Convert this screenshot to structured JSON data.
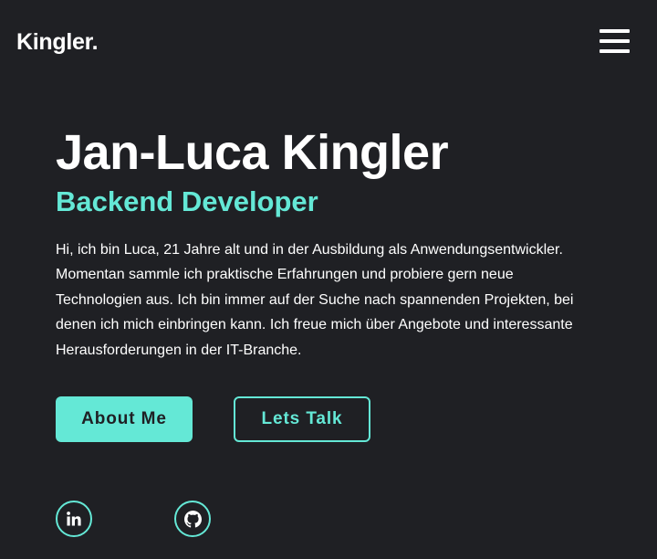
{
  "header": {
    "logo": "Kingler.",
    "menu_icon": "hamburger-menu-icon"
  },
  "hero": {
    "name": "Jan-Luca Kingler",
    "role": "Backend Developer",
    "intro": "Hi, ich bin Luca, 21 Jahre alt und in der Ausbildung als Anwendungsentwickler. Momentan sammle ich praktische Erfahrungen und probiere gern neue Technologien aus. Ich bin immer auf der Suche nach spannenden Projekten, bei denen ich mich einbringen kann. Ich freue mich über Angebote und interessante Herausforderungen in der IT-Branche."
  },
  "buttons": {
    "about": "About Me",
    "talk": "Lets Talk"
  },
  "social": {
    "linkedin_icon": "linkedin-icon",
    "github_icon": "github-icon"
  },
  "colors": {
    "background": "#1f2024",
    "accent": "#64e8d6",
    "text": "#ffffff"
  }
}
